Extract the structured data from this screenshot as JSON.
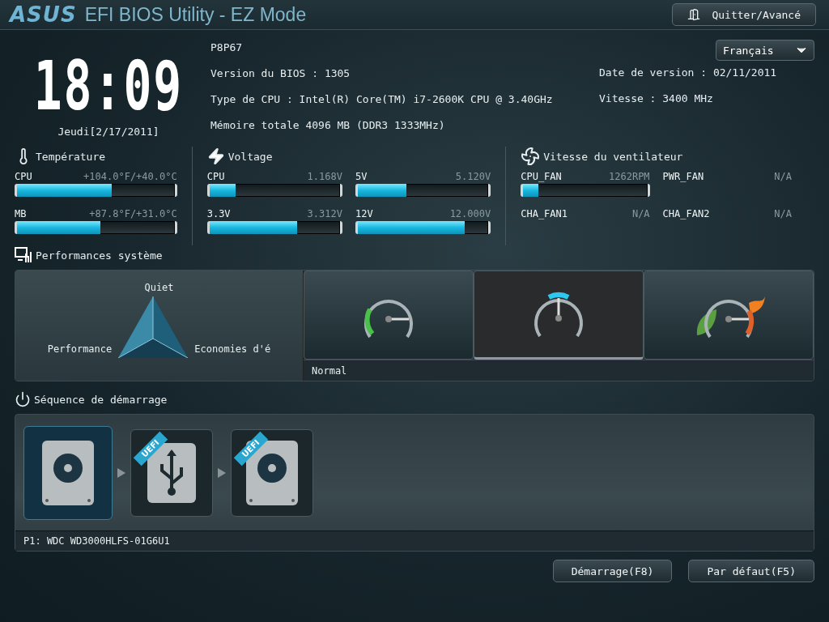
{
  "header": {
    "logo": "ASUS",
    "title": "EFI BIOS Utility - EZ Mode",
    "exit_button": "Quitter/Avancé"
  },
  "clock": {
    "time": "18:09",
    "date": "Jeudi[2/17/2011]"
  },
  "system_info": {
    "left": [
      "P8P67",
      "Version du BIOS : 1305",
      "Type de CPU : Intel(R) Core(TM) i7-2600K CPU @ 3.40GHz",
      "Mémoire totale 4096 MB (DDR3 1333MHz)"
    ],
    "language": "Français",
    "right": [
      "Date de version : 02/11/2011",
      "Vitesse :  3400 MHz"
    ]
  },
  "monitors": [
    {
      "kind": "temperature",
      "title": "Température",
      "items": [
        {
          "name": "CPU",
          "reading": "+104.0°F/+40.0°C",
          "level": 0.6
        },
        {
          "name": "MB",
          "reading": "+87.8°F/+31.0°C",
          "level": 0.53
        }
      ]
    },
    {
      "kind": "voltage",
      "title": "Voltage",
      "items": [
        {
          "name": "CPU",
          "reading": "1.168V",
          "level": 0.2
        },
        {
          "name": "5V",
          "reading": "5.120V",
          "level": 0.37
        },
        {
          "name": "3.3V",
          "reading": "3.312V",
          "level": 0.67
        },
        {
          "name": "12V",
          "reading": "12.000V",
          "level": 0.82
        }
      ]
    },
    {
      "kind": "fan",
      "title": "Vitesse du ventilateur",
      "items": [
        {
          "name": "CPU_FAN",
          "reading": "1262RPM",
          "level": 0.12
        },
        {
          "name": "PWR_FAN",
          "reading": "N/A"
        },
        {
          "name": "CHA_FAN1",
          "reading": "N/A"
        },
        {
          "name": "CHA_FAN2",
          "reading": "N/A"
        }
      ]
    }
  ],
  "performance": {
    "title": "Performances système",
    "triangle_labels": [
      "Quiet",
      "Performance",
      "Economies d'é"
    ],
    "modes": [
      {
        "kind": "quiet",
        "selected": false
      },
      {
        "kind": "normal",
        "selected": true
      },
      {
        "kind": "eco",
        "selected": false
      }
    ],
    "caption": "Normal"
  },
  "boot": {
    "title": "Séquence de démarrage",
    "devices": [
      {
        "kind": "hdd",
        "selected": true
      },
      {
        "kind": "usb",
        "badge": "UEFI",
        "selected": false
      },
      {
        "kind": "hdd",
        "badge": "UEFI",
        "selected": false
      }
    ],
    "caption": "P1: WDC WD3000HLFS-01G6U1"
  },
  "buttons": [
    "Démarrage(F8)",
    "Par défaut(F5)"
  ]
}
